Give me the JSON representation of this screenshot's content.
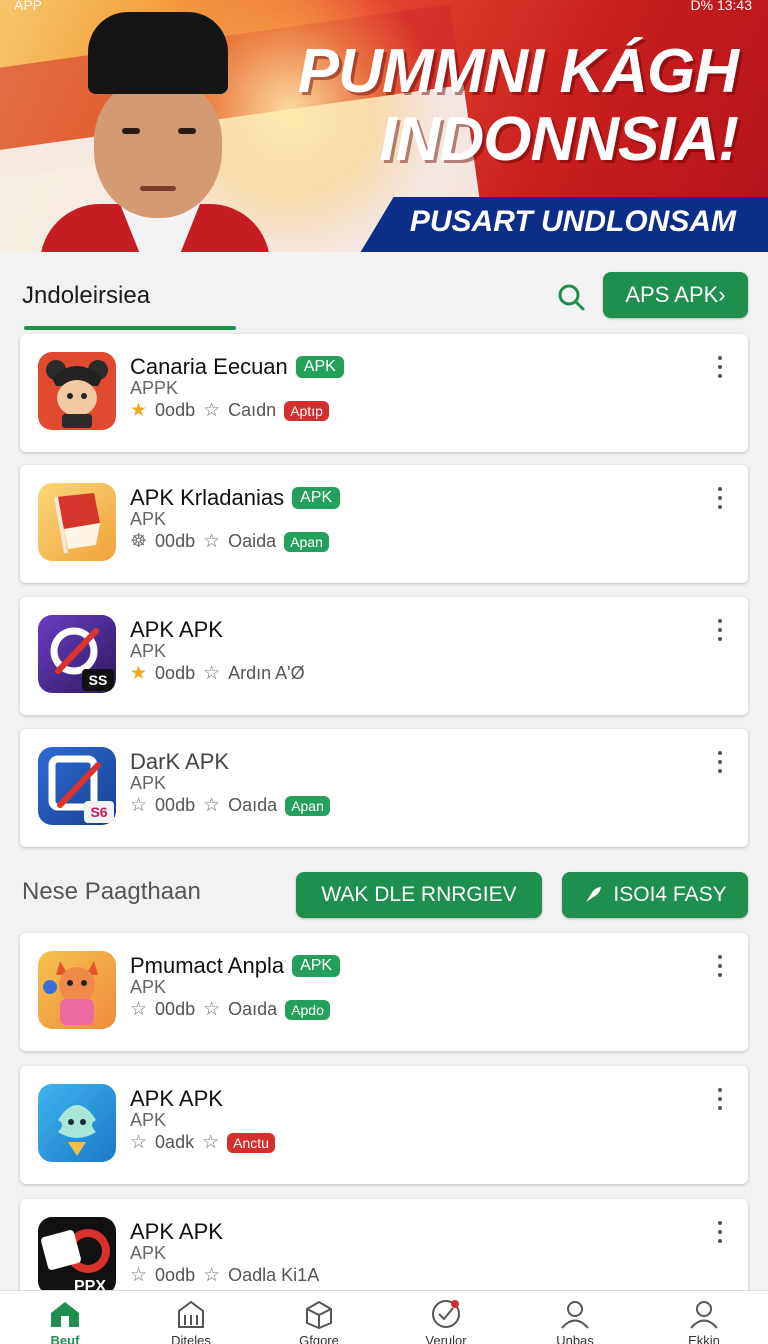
{
  "status_bar": {
    "left": "APP",
    "right": "D% 13:43"
  },
  "banner": {
    "title_line1": "PUMMNI KÁGH",
    "title_line2": "INDONNSIA!",
    "ribbon": "PUSART UNDLONSAM"
  },
  "section1": {
    "title": "Jndoleirsiea",
    "apps_button": "APS APK›"
  },
  "apps": [
    {
      "name": "Canaria Eecuan",
      "badge": "APK",
      "sub": "APPK",
      "rating": "0odb",
      "label": "Caıdn",
      "tag": "Aptıp",
      "tag_color": "r"
    },
    {
      "name": "APK Krladanias",
      "badge": "APK",
      "sub": "APK",
      "rating": "00db",
      "label": "Oaida",
      "tag": "Apan",
      "tag_color": "g"
    },
    {
      "name": "APK APK",
      "badge": "",
      "sub": "APK",
      "rating": "0odb",
      "label": "Ardın A'Ø",
      "tag": "",
      "tag_color": ""
    },
    {
      "name": "DarK APK",
      "badge": "",
      "sub": "APK",
      "rating": "00db",
      "label": "Oaıda",
      "tag": "Apan",
      "tag_color": "g"
    }
  ],
  "section2": {
    "title": "Nese Paagthaan",
    "btn1": "WAK DLE RNRGIEV",
    "btn2": "ISOI4 FASY"
  },
  "apps2": [
    {
      "name": "Pmumact Anpla",
      "badge": "APK",
      "sub": "APK",
      "rating": "00db",
      "label": "Oaıda",
      "tag": "Apdo",
      "tag_color": "g"
    },
    {
      "name": "APK APK",
      "badge": "",
      "sub": "APK",
      "rating": "0adk",
      "label": "",
      "tag": "Anctu",
      "tag_color": "r"
    },
    {
      "name": "APK APK",
      "badge": "",
      "sub": "APK",
      "rating": "0odb",
      "label": "Oadla Ki1A",
      "tag": "",
      "tag_color": ""
    }
  ],
  "nav": [
    {
      "label": "Beuf"
    },
    {
      "label": "Diteles"
    },
    {
      "label": "Gfgore"
    },
    {
      "label": "Verulor"
    },
    {
      "label": "Unbas"
    },
    {
      "label": "Ekkin"
    }
  ]
}
